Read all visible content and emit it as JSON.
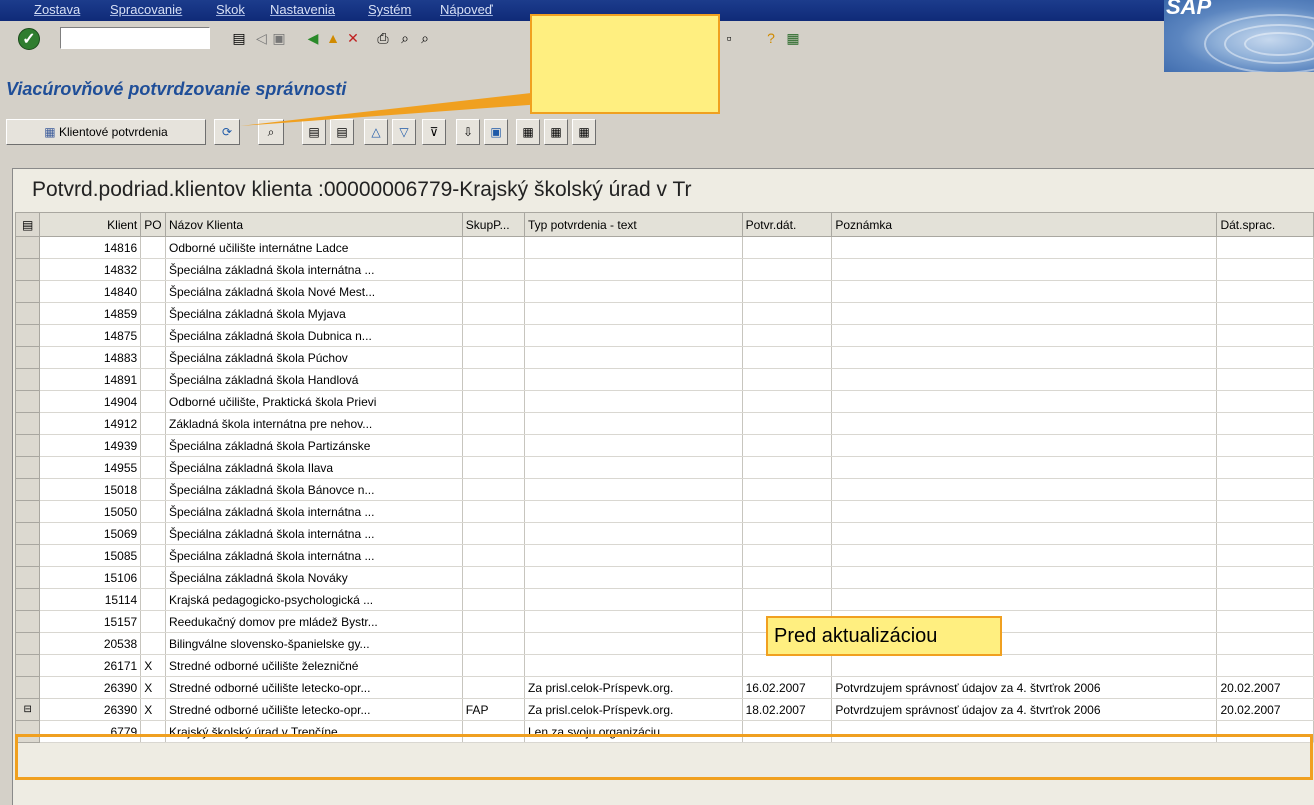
{
  "menu": [
    "Zostava",
    "Spracovanie",
    "Skok",
    "Nastavenia",
    "Systém",
    "Nápoveď"
  ],
  "window": {
    "title": "Viacúrovňové potvrdzovanie správnosti",
    "logo": "SAP"
  },
  "toolbar": {
    "command_placeholder": ""
  },
  "app_toolbar": {
    "client_confirm_label": "Klientové potvrdenia"
  },
  "grid": {
    "title": "Potvrd.podriad.klientov klienta :00000006779-Krajský školský úrad v Tr",
    "columns": [
      "Klient",
      "PO",
      "Názov Klienta",
      "SkupP...",
      "Typ potvrdenia - text",
      "Potvr.dát.",
      "Poznámka",
      "Dát.sprac."
    ],
    "rows": [
      {
        "client": "14816",
        "po": "",
        "name": "Odborné učilište internátne Ladce",
        "group": "",
        "type": "",
        "date": "",
        "note": "",
        "proc": ""
      },
      {
        "client": "14832",
        "po": "",
        "name": "Špeciálna základná škola internátna ...",
        "group": "",
        "type": "",
        "date": "",
        "note": "",
        "proc": ""
      },
      {
        "client": "14840",
        "po": "",
        "name": "Špeciálna základná škola Nové Mest...",
        "group": "",
        "type": "",
        "date": "",
        "note": "",
        "proc": ""
      },
      {
        "client": "14859",
        "po": "",
        "name": "Špeciálna základná škola Myjava",
        "group": "",
        "type": "",
        "date": "",
        "note": "",
        "proc": ""
      },
      {
        "client": "14875",
        "po": "",
        "name": "Špeciálna základná škola Dubnica n...",
        "group": "",
        "type": "",
        "date": "",
        "note": "",
        "proc": ""
      },
      {
        "client": "14883",
        "po": "",
        "name": "Špeciálna základná škola Púchov",
        "group": "",
        "type": "",
        "date": "",
        "note": "",
        "proc": ""
      },
      {
        "client": "14891",
        "po": "",
        "name": "Špeciálna základná škola Handlová",
        "group": "",
        "type": "",
        "date": "",
        "note": "",
        "proc": ""
      },
      {
        "client": "14904",
        "po": "",
        "name": "Odborné učilište, Praktická škola Prievi",
        "group": "",
        "type": "",
        "date": "",
        "note": "",
        "proc": ""
      },
      {
        "client": "14912",
        "po": "",
        "name": "Základná škola internátna pre nehov...",
        "group": "",
        "type": "",
        "date": "",
        "note": "",
        "proc": ""
      },
      {
        "client": "14939",
        "po": "",
        "name": "Špeciálna základná škola Partizánske",
        "group": "",
        "type": "",
        "date": "",
        "note": "",
        "proc": ""
      },
      {
        "client": "14955",
        "po": "",
        "name": "Špeciálna základná škola Ilava",
        "group": "",
        "type": "",
        "date": "",
        "note": "",
        "proc": ""
      },
      {
        "client": "15018",
        "po": "",
        "name": "Špeciálna základná škola Bánovce n...",
        "group": "",
        "type": "",
        "date": "",
        "note": "",
        "proc": ""
      },
      {
        "client": "15050",
        "po": "",
        "name": "Špeciálna základná škola internátna ...",
        "group": "",
        "type": "",
        "date": "",
        "note": "",
        "proc": ""
      },
      {
        "client": "15069",
        "po": "",
        "name": "Špeciálna základná škola internátna ...",
        "group": "",
        "type": "",
        "date": "",
        "note": "",
        "proc": ""
      },
      {
        "client": "15085",
        "po": "",
        "name": "Špeciálna základná škola internátna ...",
        "group": "",
        "type": "",
        "date": "",
        "note": "",
        "proc": ""
      },
      {
        "client": "15106",
        "po": "",
        "name": "Špeciálna základná škola Nováky",
        "group": "",
        "type": "",
        "date": "",
        "note": "",
        "proc": ""
      },
      {
        "client": "15114",
        "po": "",
        "name": "Krajská pedagogicko-psychologická ...",
        "group": "",
        "type": "",
        "date": "",
        "note": "",
        "proc": ""
      },
      {
        "client": "15157",
        "po": "",
        "name": "Reedukačný domov pre mládež Bystr...",
        "group": "",
        "type": "",
        "date": "",
        "note": "",
        "proc": ""
      },
      {
        "client": "20538",
        "po": "",
        "name": "Bilingválne slovensko-španielske gy...",
        "group": "",
        "type": "",
        "date": "",
        "note": "",
        "proc": ""
      },
      {
        "client": "26171",
        "po": "X",
        "name": "Stredné odborné učilište železničné",
        "group": "",
        "type": "",
        "date": "",
        "note": "",
        "proc": ""
      },
      {
        "client": "26390",
        "po": "X",
        "name": "Stredné odborné učilište letecko-opr...",
        "group": "",
        "type": "Za prisl.celok-Príspevk.org.",
        "date": "16.02.2007",
        "note": "Potvrdzujem správnosť údajov za 4. štvrťrok 2006",
        "proc": "20.02.2007"
      },
      {
        "client": "26390",
        "po": "X",
        "name": "Stredné odborné učilište letecko-opr...",
        "group": "FAP",
        "type": "Za prisl.celok-Príspevk.org.",
        "date": "18.02.2007",
        "note": "Potvrdzujem správnosť údajov za 4. štvrťrok 2006",
        "proc": "20.02.2007"
      },
      {
        "client": "6779",
        "po": "",
        "name": "Krajský školský úrad v Trenčíne",
        "group": "",
        "type": "Len za svoju organizáciu",
        "date": "",
        "note": "",
        "proc": ""
      }
    ]
  },
  "annotation": {
    "label": "Pred aktualizáciou",
    "color": "#f0a020",
    "fill": "#ffef80"
  }
}
